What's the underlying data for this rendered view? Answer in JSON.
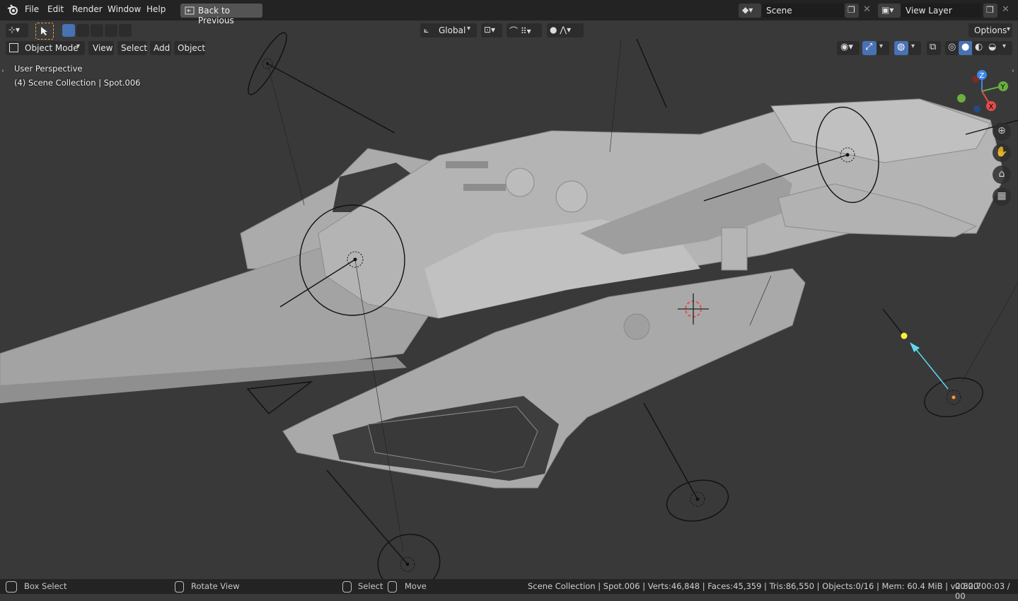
{
  "menu": {
    "items": [
      "File",
      "Edit",
      "Render",
      "Window",
      "Help"
    ],
    "back_button": "Back to Previous"
  },
  "scene": {
    "value": "Scene"
  },
  "view_layer": {
    "value": "View Layer"
  },
  "header": {
    "transform_orientation": "Global",
    "options_label": "Options",
    "mode": "Object Mode",
    "menus": [
      "View",
      "Select",
      "Add",
      "Object"
    ]
  },
  "viewport": {
    "perspective": "User Perspective",
    "collection_info": "(4) Scene Collection | Spot.006",
    "gizmo_axes": {
      "z": "Z",
      "y": "Y",
      "x": "X"
    }
  },
  "icons": {
    "blender_logo": "blender-icon",
    "back": "back-icon",
    "scene": "scene-icon",
    "view_layer": "view-layer-icon",
    "copy": "copy-icon",
    "close": "close-icon",
    "select_tool": "cursor-icon",
    "zoom": "zoom-icon",
    "pan": "hand-icon",
    "camera": "camera-icon",
    "grid": "grid-icon"
  },
  "colors": {
    "topbar": "#232323",
    "viewport_bg": "#393939",
    "accent_blue": "#4772b3",
    "axis_x": "#e64b4b",
    "axis_y": "#6cae3e",
    "axis_z": "#3d86e6",
    "light_selected": "#ffee44",
    "light_direction": "#5fd7ee"
  },
  "statusbar": {
    "box_select": "Box Select",
    "rotate_view": "Rotate View",
    "select": "Select",
    "move": "Move",
    "stats": "Scene Collection | Spot.006 | Verts:46,848 | Faces:45,359 | Tris:86,550 | Objects:0/16 | Mem: 60.4 MiB | v2.82.7",
    "time": "00:00:00:03 / 00"
  }
}
